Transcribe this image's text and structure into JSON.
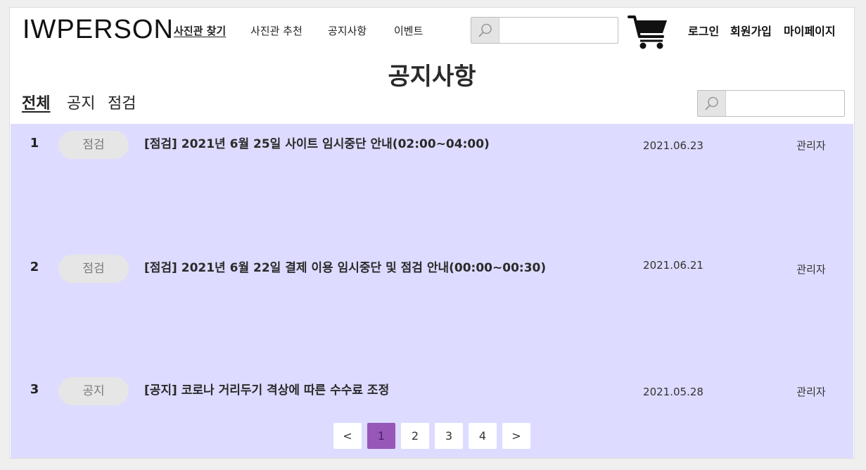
{
  "header": {
    "logo": "IWPERSON",
    "nav": [
      {
        "label": "사진관 찾기",
        "active": true
      },
      {
        "label": "사진관 추천",
        "active": false
      },
      {
        "label": "공지사항",
        "active": false
      },
      {
        "label": "이벤트",
        "active": false
      }
    ],
    "search": {
      "placeholder": "",
      "value": "",
      "icon": "search-icon"
    },
    "cart_icon": "shopping-cart-icon",
    "user_links": [
      "로그인",
      "회원가입",
      "마이페이지"
    ]
  },
  "page": {
    "title": "공지사항",
    "filters": [
      {
        "label": "전체",
        "active": true
      },
      {
        "label": "공지",
        "active": false
      },
      {
        "label": "점검",
        "active": false
      }
    ],
    "search": {
      "placeholder": "",
      "value": "",
      "icon": "search-icon"
    }
  },
  "notices": [
    {
      "num": "1",
      "category": "점검",
      "title": "[점검] 2021년 6월 25일 사이트 임시중단 안내(02:00~04:00)",
      "date": "2021.06.23",
      "author": "관리자"
    },
    {
      "num": "2",
      "category": "점검",
      "title": "[점검] 2021년 6월 22일 결제 이용 임시중단 및 점검 안내(00:00~00:30)",
      "date": "2021.06.21",
      "author": "관리자"
    },
    {
      "num": "3",
      "category": "공지",
      "title": "[공지] 코로나 거리두기 격상에 따른 수수료 조정",
      "date": "2021.05.28",
      "author": "관리자"
    }
  ],
  "pagination": {
    "prev": "<",
    "pages": [
      "1",
      "2",
      "3",
      "4"
    ],
    "current": "1",
    "next": ">"
  },
  "colors": {
    "list_background": "#dddbff",
    "current_page": "#9657b8",
    "badge_background": "#e6e6e6"
  }
}
